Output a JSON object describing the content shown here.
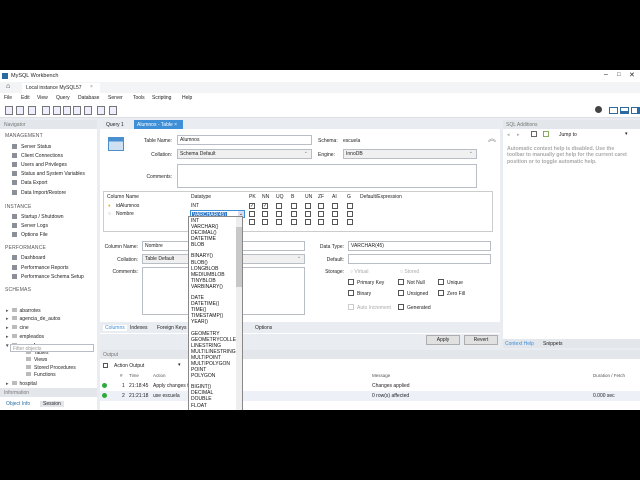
{
  "app": {
    "title": "MySQL Workbench",
    "connection_tab": "Local instance MySQL57"
  },
  "menu": [
    "File",
    "Edit",
    "View",
    "Query",
    "Database",
    "Server",
    "Tools",
    "Scripting",
    "Help"
  ],
  "navigator": {
    "title": "Navigator",
    "management": {
      "title": "MANAGEMENT",
      "items": [
        "Server Status",
        "Client Connections",
        "Users and Privileges",
        "Status and System Variables",
        "Data Export",
        "Data Import/Restore"
      ]
    },
    "instance": {
      "title": "INSTANCE",
      "items": [
        "Startup / Shutdown",
        "Server Logs",
        "Options File"
      ]
    },
    "performance": {
      "title": "PERFORMANCE",
      "items": [
        "Dashboard",
        "Performance Reports",
        "Performance Schema Setup"
      ]
    },
    "schemas": {
      "title": "SCHEMAS",
      "filter_placeholder": "Filter objects",
      "items": [
        "abarrotes",
        "agencia_de_autos",
        "cine",
        "empleados",
        "escuela",
        "Tables",
        "Views",
        "Stored Procedures",
        "Functions",
        "hospital",
        "id_cliente"
      ]
    },
    "information": "Information",
    "info_tabs": [
      "Object Info",
      "Session"
    ]
  },
  "tabs": [
    "Query 1",
    "Alumnos - Table"
  ],
  "editor": {
    "table_name_label": "Table Name:",
    "table_name": "Alumnos",
    "schema_label": "Schema:",
    "schema": "escuela",
    "collation_label": "Collation:",
    "collation": "Schema Default",
    "engine_label": "Engine:",
    "engine": "InnoDB",
    "comments_label": "Comments:",
    "grid": {
      "headers": [
        "Column Name",
        "Datatype",
        "PK",
        "NN",
        "UQ",
        "B",
        "UN",
        "ZF",
        "AI",
        "G",
        "Default/Expression"
      ],
      "rows": [
        {
          "name": "idAlumnos",
          "type": "INT",
          "flags": [
            true,
            true,
            false,
            false,
            false,
            false,
            false,
            false
          ]
        },
        {
          "name": "Nombre",
          "type": "VARCHAR(45)",
          "flags": [
            false,
            false,
            false,
            false,
            false,
            false,
            false,
            false
          ]
        }
      ]
    },
    "datatype_options": [
      "INT",
      "VARCHAR()",
      "DECIMAL()",
      "DATETIME",
      "BLOB",
      "",
      "BINARY()",
      "BLOB()",
      "LONGBLOB",
      "MEDIUMBLOB",
      "TINYBLOB",
      "VARBINARY()",
      "",
      "DATE",
      "DATETIME()",
      "TIME()",
      "TIMESTAMP()",
      "YEAR()",
      "",
      "GEOMETRY",
      "GEOMETRYCOLLECTION",
      "LINESTRING",
      "MULTILINESTRING",
      "MULTIPOINT",
      "MULTIPOLYGON",
      "POINT",
      "POLYGON",
      "",
      "BIGINT()",
      "DECIMAL",
      "DOUBLE",
      "FLOAT"
    ],
    "detail": {
      "column_name_label": "Column Name:",
      "column_name": "Nombre",
      "collation_label": "Collation:",
      "collation": "Table Default",
      "comments_label": "Comments:",
      "data_type_label": "Data Type:",
      "data_type": "VARCHAR(45)",
      "default_label": "Default:",
      "storage_label": "Storage:",
      "virtual": "Virtual",
      "stored": "Stored",
      "primary_key": "Primary Key",
      "not_null": "Not Null",
      "unique": "Unique",
      "binary": "Binary",
      "unsigned": "Unsigned",
      "zero_fill": "Zero Fill",
      "auto_increment": "Auto Increment",
      "generated": "Generated"
    },
    "bottom_tabs": [
      "Columns",
      "Indexes",
      "Foreign Keys",
      "Options"
    ],
    "apply": "Apply",
    "revert": "Revert"
  },
  "sql_additions": {
    "title": "SQL Additions",
    "jump_to": "Jump to",
    "help_text": "Automatic context help is disabled. Use the toolbar to manually get help for the current caret position or to toggle automatic help.",
    "tabs": [
      "Context Help",
      "Snippets"
    ]
  },
  "output": {
    "title": "Output",
    "selector": "Action Output",
    "headers": [
      "#",
      "Time",
      "Action",
      "Message",
      "Duration / Fetch"
    ],
    "rows": [
      {
        "n": "1",
        "time": "21:18:45",
        "action": "Apply changes to...",
        "message": "Changes applied",
        "duration": ""
      },
      {
        "n": "2",
        "time": "21:21:18",
        "action": "use escuela",
        "message": "0 row(s) affected",
        "duration": "0.000 sec"
      }
    ]
  },
  "colors": {
    "tab_active": "#3d8fd8",
    "success": "#2eaa3c"
  }
}
